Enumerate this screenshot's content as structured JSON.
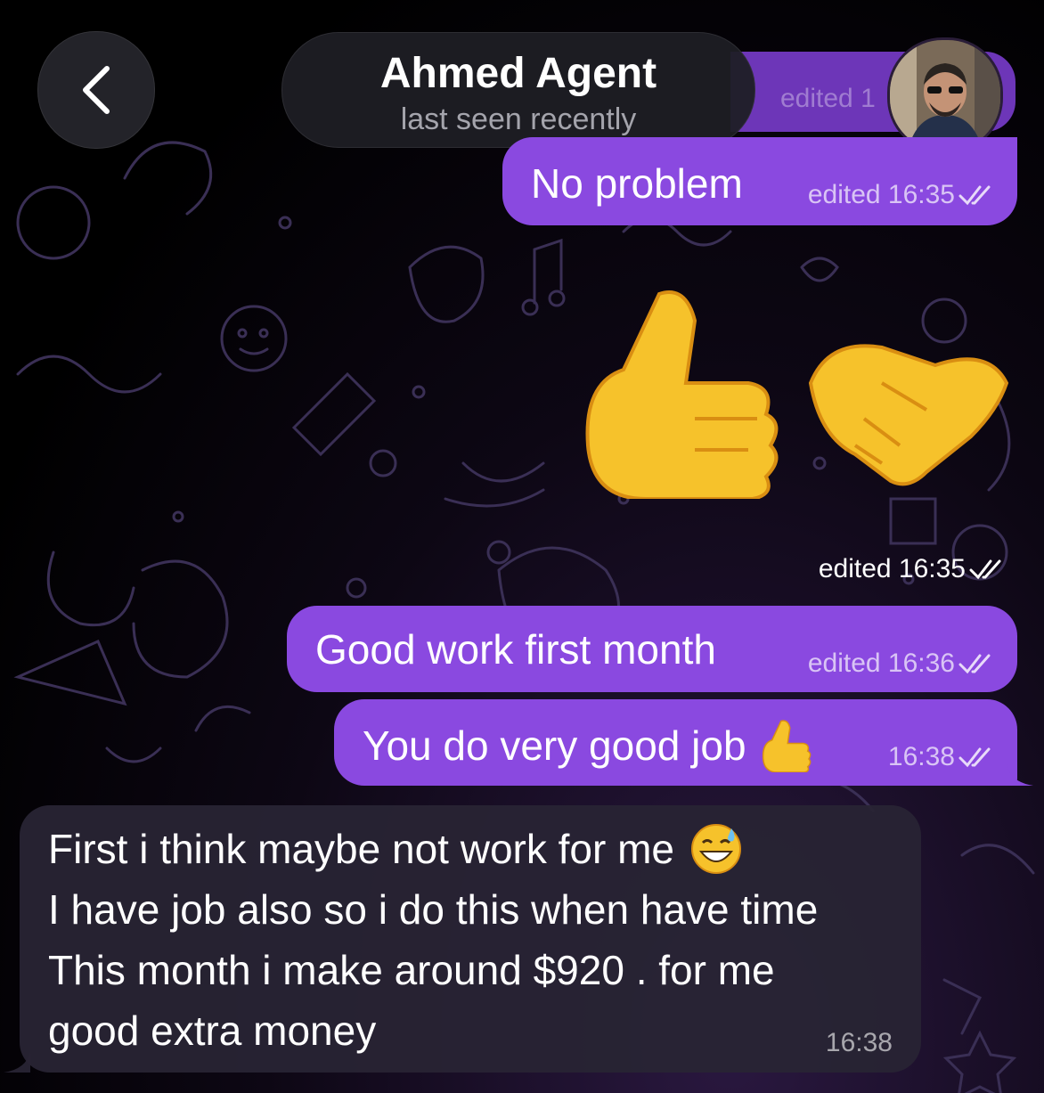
{
  "header": {
    "contact_name": "Ahmed Agent",
    "status": "last seen recently"
  },
  "icons": {
    "back": "chevron-left-icon",
    "read_receipt": "double-check-icon"
  },
  "colors": {
    "outgoing_bubble": "#8a49e0",
    "incoming_bubble": "#28243a",
    "background": "#000000"
  },
  "messages": {
    "ghost": {
      "meta": "edited 1"
    },
    "no_problem": {
      "text": "No problem",
      "meta": "edited 16:35"
    },
    "emoji": {
      "meta": "edited 16:35"
    },
    "good_work": {
      "text": "Good work first month",
      "meta": "edited 16:36"
    },
    "very_good": {
      "text": "You do very good job",
      "meta": "16:38"
    },
    "incoming": {
      "line1": "First i think maybe not work for me",
      "line2": "I have job also so i do this when have time",
      "line3": "This month i make around $920 . for me",
      "line4": "good extra money",
      "time": "16:38"
    }
  }
}
